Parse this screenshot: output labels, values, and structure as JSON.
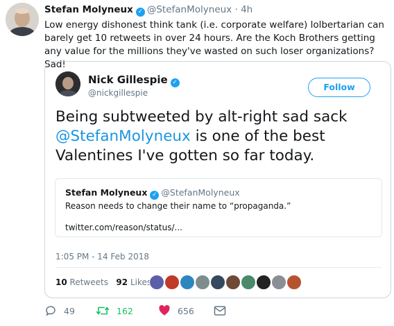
{
  "outer_tweet": {
    "display_name": "Stefan Molyneux",
    "handle": "@StefanMolyneux",
    "separator": "·",
    "time": "4h",
    "text": "Low energy dishonest think tank (i.e. corporate welfare) lolbertarian can barely get 10 retweets in over 24 hours. Are the Koch Brothers getting any value for the millions they've wasted on such loser organizations? Sad!"
  },
  "quoted_tweet": {
    "display_name": "Nick Gillespie",
    "handle": "@nickgillespie",
    "follow_label": "Follow",
    "text_before": "Being subtweeted by alt-right sad sack ",
    "mention": "@StefanMolyneux",
    "text_after": " is one of the best Valentines I've gotten so far today.",
    "timestamp": "1:05 PM - 14 Feb 2018",
    "retweets_count": "10",
    "retweets_label": "Retweets",
    "likes_count": "92",
    "likes_label": "Likes"
  },
  "inner_quote": {
    "display_name": "Stefan Molyneux",
    "handle": "@StefanMolyneux",
    "text": "Reason needs to change their name to “propaganda.”",
    "link": "twitter.com/reason/status/..."
  },
  "actions": {
    "reply_count": "49",
    "retweet_count": "162",
    "like_count": "656"
  },
  "colors": {
    "verified": "#1da1f2",
    "mention": "#1b95e0",
    "retweet": "#17bf63",
    "like": "#e0245e",
    "muted": "#657786"
  },
  "icons": [
    "verified-badge-icon",
    "reply-icon",
    "retweet-icon",
    "like-icon",
    "message-icon"
  ]
}
